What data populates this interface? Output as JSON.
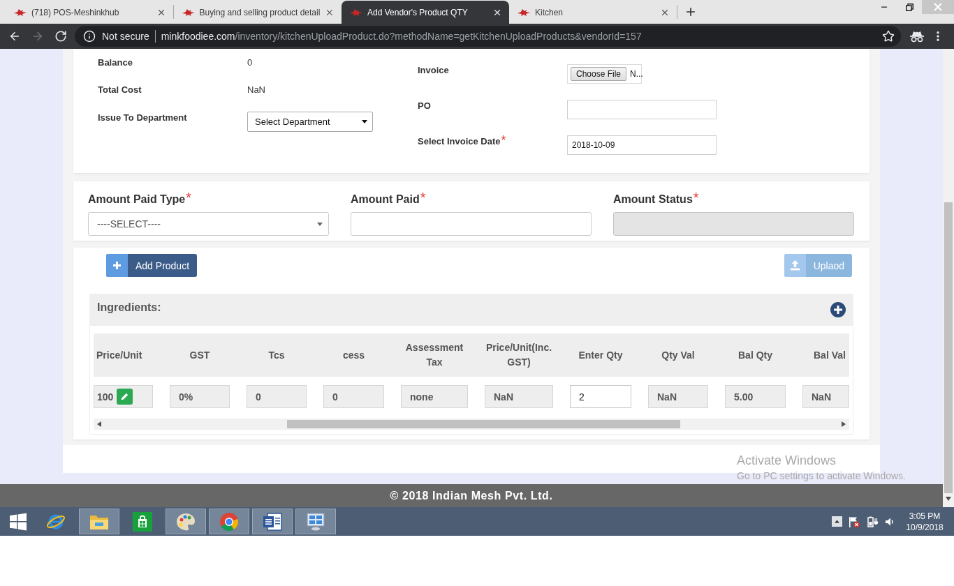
{
  "browser": {
    "tabs": [
      {
        "title": "(718) POS-Meshinkhub",
        "selected": false
      },
      {
        "title": "Buying and selling product detail",
        "selected": false
      },
      {
        "title": "Add Vendor's Product QTY",
        "selected": true
      },
      {
        "title": "Kitchen",
        "selected": false
      }
    ],
    "security_label": "Not secure",
    "url": {
      "host": "minkfoodiee.com",
      "path": "/inventory/kitchenUploadProduct.do?methodName=getKitchenUploadProducts&vendorId=157"
    }
  },
  "stock_details": {
    "left_fields": [
      {
        "kind": "text",
        "label": "Balance",
        "value": "0"
      },
      {
        "kind": "text",
        "label": "Total Cost",
        "value": "NaN"
      },
      {
        "kind": "select",
        "label": "Issue To Department",
        "value": "Select Department"
      }
    ],
    "right_fields": [
      {
        "kind": "file",
        "label": "Invoice",
        "button": "Choose File",
        "value": "N..."
      },
      {
        "kind": "input",
        "label": "PO"
      },
      {
        "kind": "input",
        "label": "Select Invoice Date",
        "required_mark": "*",
        "value": "2018-10-09"
      }
    ]
  },
  "payment": [
    {
      "kind": "select",
      "label": "Amount Paid Type",
      "required_mark": "*",
      "value": "----SELECT----",
      "disabled": false
    },
    {
      "kind": "input",
      "label": "Amount Paid",
      "required_mark": "*",
      "disabled": false
    },
    {
      "kind": "input",
      "label": "Amount Status",
      "required_mark": "*",
      "disabled": true
    }
  ],
  "actions": [
    {
      "kind": "add",
      "label": "Add Product",
      "disabled": false
    },
    {
      "kind": "upload",
      "label": "Uplaod",
      "disabled": true
    }
  ],
  "ingredients": {
    "title": "Ingredients:",
    "columns": [
      "Price/Unit",
      "GST",
      "Tcs",
      "cess",
      "Assessment Tax",
      "Price/Unit(Inc. GST)",
      "Enter Qty",
      "Qty Val",
      "Bal Qty",
      "Bal Val"
    ],
    "rows": [
      {
        "cells": [
          {
            "kind": "price",
            "value": "100"
          },
          {
            "kind": "readonly",
            "value": "0%"
          },
          {
            "kind": "readonly",
            "value": "0"
          },
          {
            "kind": "readonly",
            "value": "0"
          },
          {
            "kind": "readonly",
            "value": "none"
          },
          {
            "kind": "readonly",
            "value": "NaN"
          },
          {
            "kind": "editable",
            "value": "2"
          },
          {
            "kind": "readonly",
            "value": "NaN"
          },
          {
            "kind": "readonly",
            "value": "5.00"
          },
          {
            "kind": "readonly",
            "value": "NaN"
          }
        ]
      }
    ]
  },
  "footer": {
    "text": "© 2018 Indian Mesh Pvt. Ltd."
  },
  "activation_notice": {
    "title": "Activate Windows",
    "text": "Go to PC settings to activate Windows."
  },
  "taskbar": {
    "apps": [
      {
        "kind": "ie",
        "open": false
      },
      {
        "kind": "explorer",
        "open": true
      },
      {
        "kind": "store",
        "open": false
      },
      {
        "kind": "paint",
        "open": true
      },
      {
        "kind": "chrome",
        "open": true
      },
      {
        "kind": "word",
        "open": true
      },
      {
        "kind": "control_panel",
        "open": true
      }
    ],
    "time": "3:05 PM",
    "date": "10/9/2018"
  }
}
